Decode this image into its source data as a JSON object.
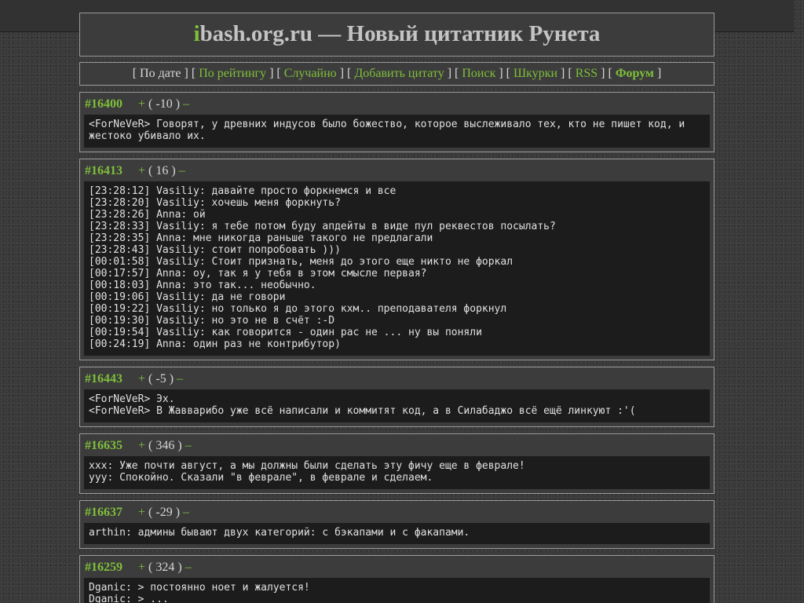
{
  "header": {
    "logo_first_letter": "i",
    "title_rest": "bash.org.ru — Новый цитатник Рунета"
  },
  "nav": {
    "items": [
      {
        "label": "По дате",
        "link": false
      },
      {
        "label": "По рейтингу",
        "link": true
      },
      {
        "label": "Случайно",
        "link": true
      },
      {
        "label": "Добавить цитату",
        "link": true
      },
      {
        "label": "Поиск",
        "link": true
      },
      {
        "label": "Шкурки",
        "link": true
      },
      {
        "label": "RSS",
        "link": true
      },
      {
        "label": "Форум",
        "link": true
      }
    ]
  },
  "vote": {
    "plus": "+",
    "minus": "–"
  },
  "quotes": [
    {
      "id": "#16400",
      "rating": "-10",
      "lines": [
        "<ForNeVeR> Говорят, у древних индусов было божество, которое выслеживало тех, кто не пишет код, и жестоко убивало их."
      ]
    },
    {
      "id": "#16413",
      "rating": "16",
      "lines": [
        "[23:28:12] Vasiliy: давайте просто форкнемся и все",
        "[23:28:20] Vasiliy: хочешь меня форкнуть?",
        "[23:28:26] Anna: ой",
        "[23:28:33] Vasiliy: я тебе потом буду апдейты в виде пул реквестов посылать?",
        "[23:28:35] Anna: мне никогда раньше такого не предлагали",
        "[23:28:43] Vasiliy: стоит попробовать )))",
        "[00:01:58] Vasiliy: Стоит признать, меня до этого еще никто не форкал",
        "[00:17:57] Anna: оу, так я у тебя в этом смысле первая?",
        "[00:18:03] Anna: это так... необычно.",
        "[00:19:06] Vasiliy: да не говори",
        "[00:19:22] Vasiliy: но только я до этого кхм.. преподавателя форкнул",
        "[00:19:30] Vasiliy: но это не в счёт :-D",
        "[00:19:54] Vasiliy: как говорится - один рас не ... ну вы поняли",
        "[00:24:19] Anna: один раз не контрибутор)"
      ]
    },
    {
      "id": "#16443",
      "rating": "-5",
      "lines": [
        "<ForNeVeR> Эх.",
        "<ForNeVeR> В Жавварибо уже всё написали и коммитят код, а в Силабаджо всё ещё линкуют :'("
      ]
    },
    {
      "id": "#16635",
      "rating": "346",
      "lines": [
        "xxx: Уже почти август, а мы должны были сделать эту фичу еще в феврале!",
        "yyy: Спокойно. Сказали \"в феврале\", в феврале и сделаем."
      ]
    },
    {
      "id": "#16637",
      "rating": "-29",
      "lines": [
        "arthin: админы бывают двух категорий: с бэкапами и с факапами."
      ]
    },
    {
      "id": "#16259",
      "rating": "324",
      "lines": [
        "Dganic: > постоянно ноет и жалуется!",
        "Dganic: > ..."
      ]
    }
  ]
}
